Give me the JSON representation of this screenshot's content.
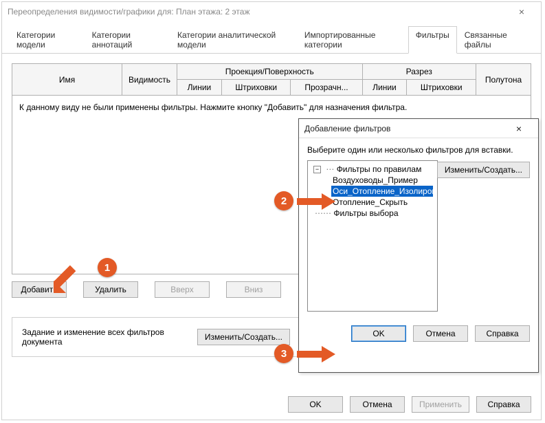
{
  "main": {
    "title": "Переопределения видимости/графики для: План этажа: 2 этаж",
    "tabs": [
      "Категории модели",
      "Категории аннотаций",
      "Категории аналитической модели",
      "Импортированные категории",
      "Фильтры",
      "Связанные файлы"
    ],
    "table": {
      "headers": {
        "name": "Имя",
        "visibility": "Видимость",
        "projection": "Проекция/Поверхность",
        "section": "Разрез",
        "halftone": "Полутона",
        "lines": "Линии",
        "patterns": "Штриховки",
        "transparency": "Прозрачн..."
      },
      "empty_msg": "К данному виду не были применены фильтры. Нажмите кнопку \"Добавить\" для назначения фильтра."
    },
    "buttons": {
      "add": "Добавить",
      "remove": "Удалить",
      "up": "Вверх",
      "down": "Вниз"
    },
    "inset": {
      "text": "Задание и изменение всех фильтров документа",
      "edit": "Изменить/Создать..."
    },
    "footer": {
      "ok": "OK",
      "cancel": "Отмена",
      "apply": "Применить",
      "help": "Справка"
    }
  },
  "dialog": {
    "title": "Добавление фильтров",
    "prompt": "Выберите один или несколько фильтров для вставки.",
    "edit": "Изменить/Создать...",
    "tree": {
      "root1": "Фильтры по правилам",
      "items": [
        "Воздуховоды_Пример",
        "Оси_Отопление_Изолировать",
        "Отопление_Скрыть"
      ],
      "root2": "Фильтры выбора"
    },
    "footer": {
      "ok": "OK",
      "cancel": "Отмена",
      "help": "Справка"
    }
  }
}
